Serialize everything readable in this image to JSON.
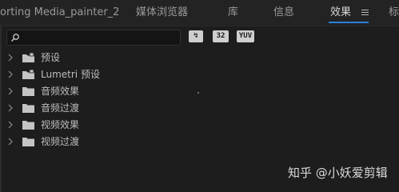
{
  "tabs": [
    {
      "label": "orting Media_painter_2",
      "active": false
    },
    {
      "label": "媒体浏览器",
      "active": false
    },
    {
      "label": "库",
      "active": false
    },
    {
      "label": "信息",
      "active": false
    },
    {
      "label": "效果",
      "active": true
    },
    {
      "label": "标",
      "active": false
    }
  ],
  "search": {
    "placeholder": ""
  },
  "filter_buttons": [
    "↯",
    "32",
    "YUV"
  ],
  "tree": [
    {
      "label": "预设",
      "icon": "preset-folder-icon"
    },
    {
      "label": "Lumetri 预设",
      "icon": "preset-folder-icon"
    },
    {
      "label": "音频效果",
      "icon": "folder-icon"
    },
    {
      "label": "音频过渡",
      "icon": "folder-icon"
    },
    {
      "label": "视频效果",
      "icon": "folder-icon"
    },
    {
      "label": "视频过渡",
      "icon": "folder-icon"
    }
  ],
  "watermark": "知乎 @小妖爱剪辑",
  "colors": {
    "accent": "#2b7fd8",
    "background": "#1d1d1d",
    "text": "#bdbdbd"
  }
}
